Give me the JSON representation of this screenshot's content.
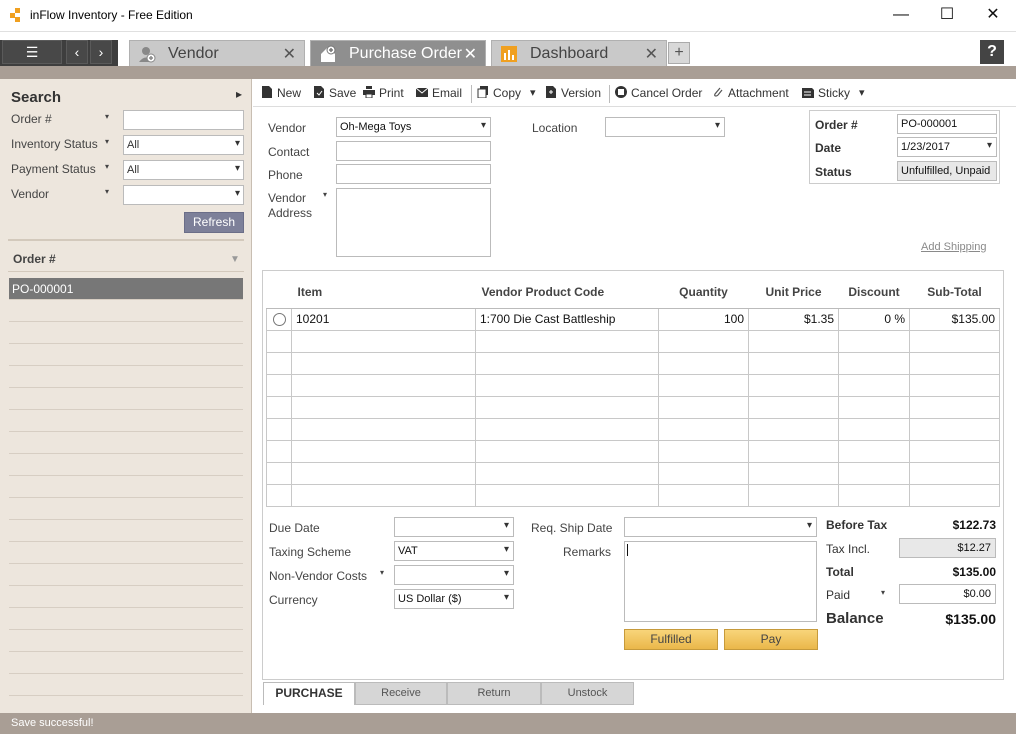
{
  "window": {
    "title": "inFlow Inventory - Free Edition",
    "minimize": "—",
    "maximize": "☐",
    "close": "✕"
  },
  "nav": {
    "menu": "☰",
    "back": "‹",
    "forward": "›",
    "add_tab": "+",
    "help": "?"
  },
  "tabs": [
    {
      "label": "Vendor",
      "icon": "vendor-icon",
      "close": "✕"
    },
    {
      "label": "Purchase Order",
      "icon": "purchase-order-icon",
      "close": "✕"
    },
    {
      "label": "Dashboard",
      "icon": "dashboard-icon",
      "close": "✕"
    }
  ],
  "search": {
    "title": "Search",
    "collapse": "▸",
    "order_label": "Order #",
    "inventory_status_label": "Inventory Status",
    "inventory_status_value": "All",
    "payment_status_label": "Payment Status",
    "payment_status_value": "All",
    "vendor_label": "Vendor",
    "vendor_value": "",
    "refresh": "Refresh",
    "dropdown_glyph": "▾"
  },
  "order_list": {
    "column": "Order #",
    "sort_arrow": "▼",
    "rows": [
      "PO-000001",
      "",
      "",
      "",
      "",
      "",
      "",
      "",
      "",
      "",
      "",
      "",
      "",
      "",
      "",
      "",
      "",
      "",
      "",
      ""
    ]
  },
  "status_bar": {
    "message": "Save successful!"
  },
  "toolbar": {
    "new": "New",
    "save": "Save",
    "print": "Print",
    "email": "Email",
    "copy": "Copy",
    "version": "Version",
    "cancel_order": "Cancel Order",
    "attachment": "Attachment",
    "sticky": "Sticky",
    "arrow": "▾"
  },
  "header": {
    "vendor_label": "Vendor",
    "vendor_value": "Oh-Mega Toys",
    "contact_label": "Contact",
    "contact_value": "",
    "phone_label": "Phone",
    "phone_value": "",
    "vendor_address_label_1": "Vendor",
    "vendor_address_label_2": "Address",
    "vendor_address_value": "",
    "location_label": "Location",
    "location_value": "",
    "order_no_label": "Order #",
    "order_no_value": "PO-000001",
    "date_label": "Date",
    "date_value": "1/23/2017",
    "status_label": "Status",
    "status_value": "Unfulfilled, Unpaid",
    "add_shipping": "Add Shipping"
  },
  "items": {
    "columns": [
      "",
      "Item",
      "Vendor Product Code",
      "Quantity",
      "Unit Price",
      "Discount",
      "Sub-Total"
    ],
    "rows": [
      {
        "item": "10201",
        "vendor_code": "1:700 Die Cast Battleship",
        "quantity": "100",
        "unit_price": "$1.35",
        "discount": "0 %",
        "subtotal": "$135.00"
      },
      {
        "item": "",
        "vendor_code": "",
        "quantity": "",
        "unit_price": "",
        "discount": "",
        "subtotal": ""
      },
      {
        "item": "",
        "vendor_code": "",
        "quantity": "",
        "unit_price": "",
        "discount": "",
        "subtotal": ""
      },
      {
        "item": "",
        "vendor_code": "",
        "quantity": "",
        "unit_price": "",
        "discount": "",
        "subtotal": ""
      },
      {
        "item": "",
        "vendor_code": "",
        "quantity": "",
        "unit_price": "",
        "discount": "",
        "subtotal": ""
      },
      {
        "item": "",
        "vendor_code": "",
        "quantity": "",
        "unit_price": "",
        "discount": "",
        "subtotal": ""
      },
      {
        "item": "",
        "vendor_code": "",
        "quantity": "",
        "unit_price": "",
        "discount": "",
        "subtotal": ""
      },
      {
        "item": "",
        "vendor_code": "",
        "quantity": "",
        "unit_price": "",
        "discount": "",
        "subtotal": ""
      },
      {
        "item": "",
        "vendor_code": "",
        "quantity": "",
        "unit_price": "",
        "discount": "",
        "subtotal": ""
      }
    ]
  },
  "footer": {
    "due_date_label": "Due Date",
    "due_date_value": "",
    "taxing_scheme_label": "Taxing Scheme",
    "taxing_scheme_value": "VAT",
    "non_vendor_costs_label": "Non-Vendor Costs",
    "non_vendor_costs_value": "",
    "currency_label": "Currency",
    "currency_value": "US Dollar  ($)",
    "req_ship_date_label": "Req. Ship Date",
    "req_ship_date_value": "",
    "remarks_label": "Remarks",
    "remarks_value": "",
    "fulfilled": "Fulfilled",
    "pay": "Pay"
  },
  "summary": {
    "before_tax_label": "Before Tax",
    "before_tax_value": "$122.73",
    "tax_incl_label": "Tax Incl.",
    "tax_incl_value": "$12.27",
    "total_label": "Total",
    "total_value": "$135.00",
    "paid_label": "Paid",
    "paid_value": "$0.00",
    "balance_label": "Balance",
    "balance_value": "$135.00"
  },
  "bottom_tabs": [
    "PURCHASE",
    "Receive",
    "Return",
    "Unstock"
  ],
  "colors": {
    "accent_brown": "#a99e95",
    "panel_bg": "#ede6dd",
    "button_gold": "#eab74a",
    "refresh_blue": "#7d8099"
  }
}
